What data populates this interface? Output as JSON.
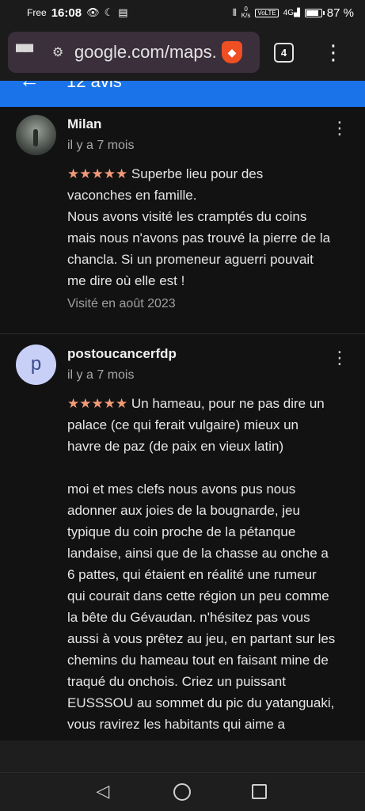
{
  "status": {
    "carrier": "Free",
    "time": "16:08",
    "speed_top": "0",
    "speed_bottom": "K/s",
    "volte": "VoLTE",
    "network": "4G",
    "battery_pct": "87 %",
    "battery_level": 0.87
  },
  "browser": {
    "url": "google.com/maps.",
    "tab_count": "4"
  },
  "header": {
    "title": "12 avis"
  },
  "reviews": [
    {
      "author": "Milan",
      "time_ago": "il y a 7 mois",
      "stars": "★★★★★",
      "lines": [
        " Superbe lieu pour des",
        "vaconches en famille.",
        "Nous avons visité les cramptés du coins",
        "mais nous n'avons pas trouvé la pierre de la",
        "chancla. Si un promeneur aguerri pouvait",
        "me dire où elle est !"
      ],
      "visited": "Visité en août 2023"
    },
    {
      "author": "postoucancerfdp",
      "avatar_letter": "p",
      "time_ago": "il y a 7 mois",
      "stars": "★★★★★",
      "lines": [
        " Un hameau, pour ne pas dire un",
        "palace (ce qui ferait vulgaire) mieux un",
        "havre de paz (de paix en vieux latin)",
        "",
        "moi et mes clefs nous avons pus nous",
        "adonner aux joies de la bougnarde, jeu",
        "typique du coin proche de la pétanque",
        "landaise, ainsi que de la chasse au onche a",
        "6 pattes, qui étaient en réalité une rumeur",
        "qui courait dans cette région un peu comme",
        "la bête du Gévaudan. n'hésitez pas vous",
        "aussi à vous prêtez au jeu, en partant sur les",
        "chemins du hameau tout en faisant mine de",
        "traqué du onchois. Criez un puissant",
        "EUSSSOU au sommet du pic du yatanguaki,",
        "vous ravirez les habitants qui aime a"
      ]
    }
  ],
  "colors": {
    "background": "#121212",
    "accent_blue": "#1a73e8",
    "star": "#f29a77"
  }
}
